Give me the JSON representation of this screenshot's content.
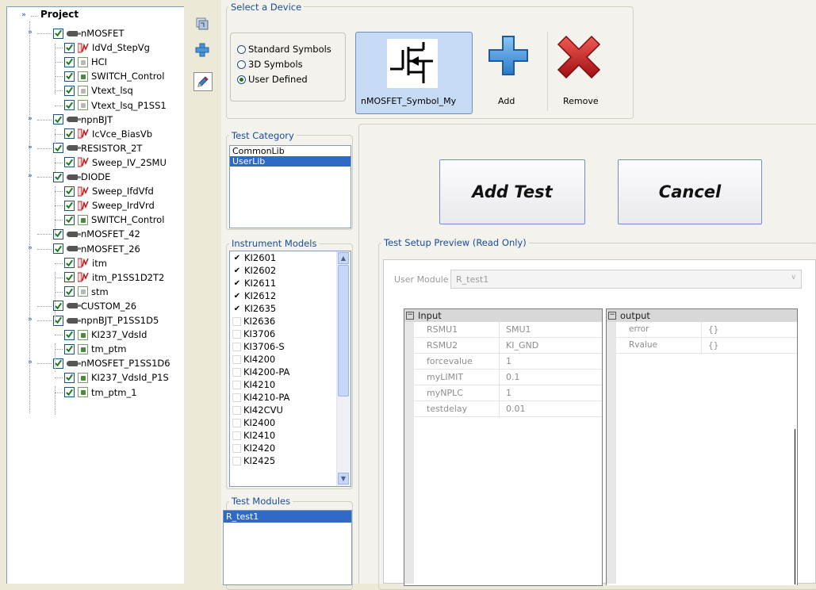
{
  "tree": {
    "root_label": "Project",
    "nodes": [
      {
        "label": "nMOSFET",
        "kind": "device",
        "level": 1
      },
      {
        "label": "IdVd_StepVg",
        "kind": "test",
        "level": 2
      },
      {
        "label": "HCI",
        "kind": "module-grey",
        "level": 2
      },
      {
        "label": "SWITCH_Control",
        "kind": "module",
        "level": 2
      },
      {
        "label": "Vtext_lsq",
        "kind": "module-grey",
        "level": 2
      },
      {
        "label": "Vtext_lsq_P1SS1",
        "kind": "module-grey",
        "level": 2
      },
      {
        "label": "npnBJT",
        "kind": "device",
        "level": 1
      },
      {
        "label": "IcVce_BiasVb",
        "kind": "test",
        "level": 2
      },
      {
        "label": "RESISTOR_2T",
        "kind": "device",
        "level": 1
      },
      {
        "label": "Sweep_IV_2SMU",
        "kind": "test",
        "level": 2
      },
      {
        "label": "DIODE",
        "kind": "device",
        "level": 1
      },
      {
        "label": "Sweep_IfdVfd",
        "kind": "test",
        "level": 2
      },
      {
        "label": "Sweep_IrdVrd",
        "kind": "test",
        "level": 2
      },
      {
        "label": "SWITCH_Control",
        "kind": "module",
        "level": 2
      },
      {
        "label": "nMOSFET_42",
        "kind": "device",
        "level": 1
      },
      {
        "label": "nMOSFET_26",
        "kind": "device",
        "level": 1
      },
      {
        "label": "itm",
        "kind": "test",
        "level": 2
      },
      {
        "label": "itm_P1SS1D2T2",
        "kind": "test",
        "level": 2
      },
      {
        "label": "stm",
        "kind": "module-grey",
        "level": 2
      },
      {
        "label": "CUSTOM_26",
        "kind": "device",
        "level": 1
      },
      {
        "label": "npnBJT_P1SS1D5",
        "kind": "device",
        "level": 1
      },
      {
        "label": "KI237_VdsId",
        "kind": "module",
        "level": 2
      },
      {
        "label": "tm_ptm",
        "kind": "module",
        "level": 2
      },
      {
        "label": "nMOSFET_P1SS1D6",
        "kind": "device",
        "level": 1
      },
      {
        "label": "KI237_VdsId_P1S",
        "kind": "module",
        "level": 2
      },
      {
        "label": "tm_ptm_1",
        "kind": "module",
        "level": 2
      }
    ]
  },
  "toolbar": {
    "icons": [
      "copy-device-icon",
      "add-icon",
      "edit-icon"
    ]
  },
  "select_device": {
    "title": "Select a Device",
    "options": [
      "Standard Symbols",
      "3D Symbols",
      "User Defined"
    ],
    "selected_index": 2,
    "symbol_label": "nMOSFET_Symbol_My",
    "add_label": "Add",
    "remove_label": "Remove"
  },
  "test_category": {
    "title": "Test Category",
    "items": [
      "CommonLib",
      "UserLib"
    ],
    "selected_index": 1
  },
  "instrument_models": {
    "title": "Instrument Models",
    "items": [
      {
        "label": "KI2601",
        "checked": true
      },
      {
        "label": "KI2602",
        "checked": true
      },
      {
        "label": "KI2611",
        "checked": true
      },
      {
        "label": "KI2612",
        "checked": true
      },
      {
        "label": "KI2635",
        "checked": true
      },
      {
        "label": "KI2636",
        "checked": false
      },
      {
        "label": "KI3706",
        "checked": false
      },
      {
        "label": "KI3706-S",
        "checked": false
      },
      {
        "label": "KI4200",
        "checked": false
      },
      {
        "label": "KI4200-PA",
        "checked": false
      },
      {
        "label": "KI4210",
        "checked": false
      },
      {
        "label": "KI4210-PA",
        "checked": false
      },
      {
        "label": "KI42CVU",
        "checked": false
      },
      {
        "label": "KI2400",
        "checked": false
      },
      {
        "label": "KI2410",
        "checked": false
      },
      {
        "label": "KI2420",
        "checked": false
      },
      {
        "label": "KI2425",
        "checked": false
      }
    ]
  },
  "test_modules": {
    "title": "Test Modules",
    "items": [
      "R_test1"
    ],
    "selected_index": 0
  },
  "actions": {
    "add_test": "Add Test",
    "cancel": "Cancel"
  },
  "preview": {
    "title": "Test Setup Preview (Read Only)",
    "user_module_label": "User Module",
    "user_module_value": "R_test1",
    "input": {
      "header": "Input",
      "rows": [
        {
          "k": "RSMU1",
          "v": "SMU1"
        },
        {
          "k": "RSMU2",
          "v": "KI_GND"
        },
        {
          "k": "forcevalue",
          "v": "1"
        },
        {
          "k": "myLIMIT",
          "v": "0.1"
        },
        {
          "k": "myNPLC",
          "v": "1"
        },
        {
          "k": "testdelay",
          "v": "0.01"
        }
      ]
    },
    "output": {
      "header": "output",
      "rows": [
        {
          "k": "error",
          "v": "{}"
        },
        {
          "k": "Rvalue",
          "v": "{}"
        }
      ]
    }
  },
  "colors": {
    "accent": "#316ac5",
    "group_title": "#1a4d96",
    "remove_red": "#c8191c",
    "add_blue": "#3d8fd6"
  }
}
